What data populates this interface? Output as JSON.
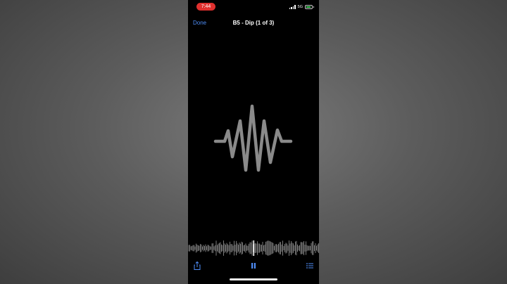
{
  "status_bar": {
    "time": "7:44",
    "network": "5G",
    "accent_color": "#e0302e"
  },
  "nav": {
    "done_label": "Done",
    "title": "B5 - Dip (1 of 3)"
  },
  "icons": {
    "main": "waveform-icon",
    "share": "share-icon",
    "pause": "pause-icon",
    "list": "list-icon"
  },
  "colors": {
    "accent": "#4e8cf5",
    "waveform": "#8a8a8a",
    "background": "#000000"
  }
}
